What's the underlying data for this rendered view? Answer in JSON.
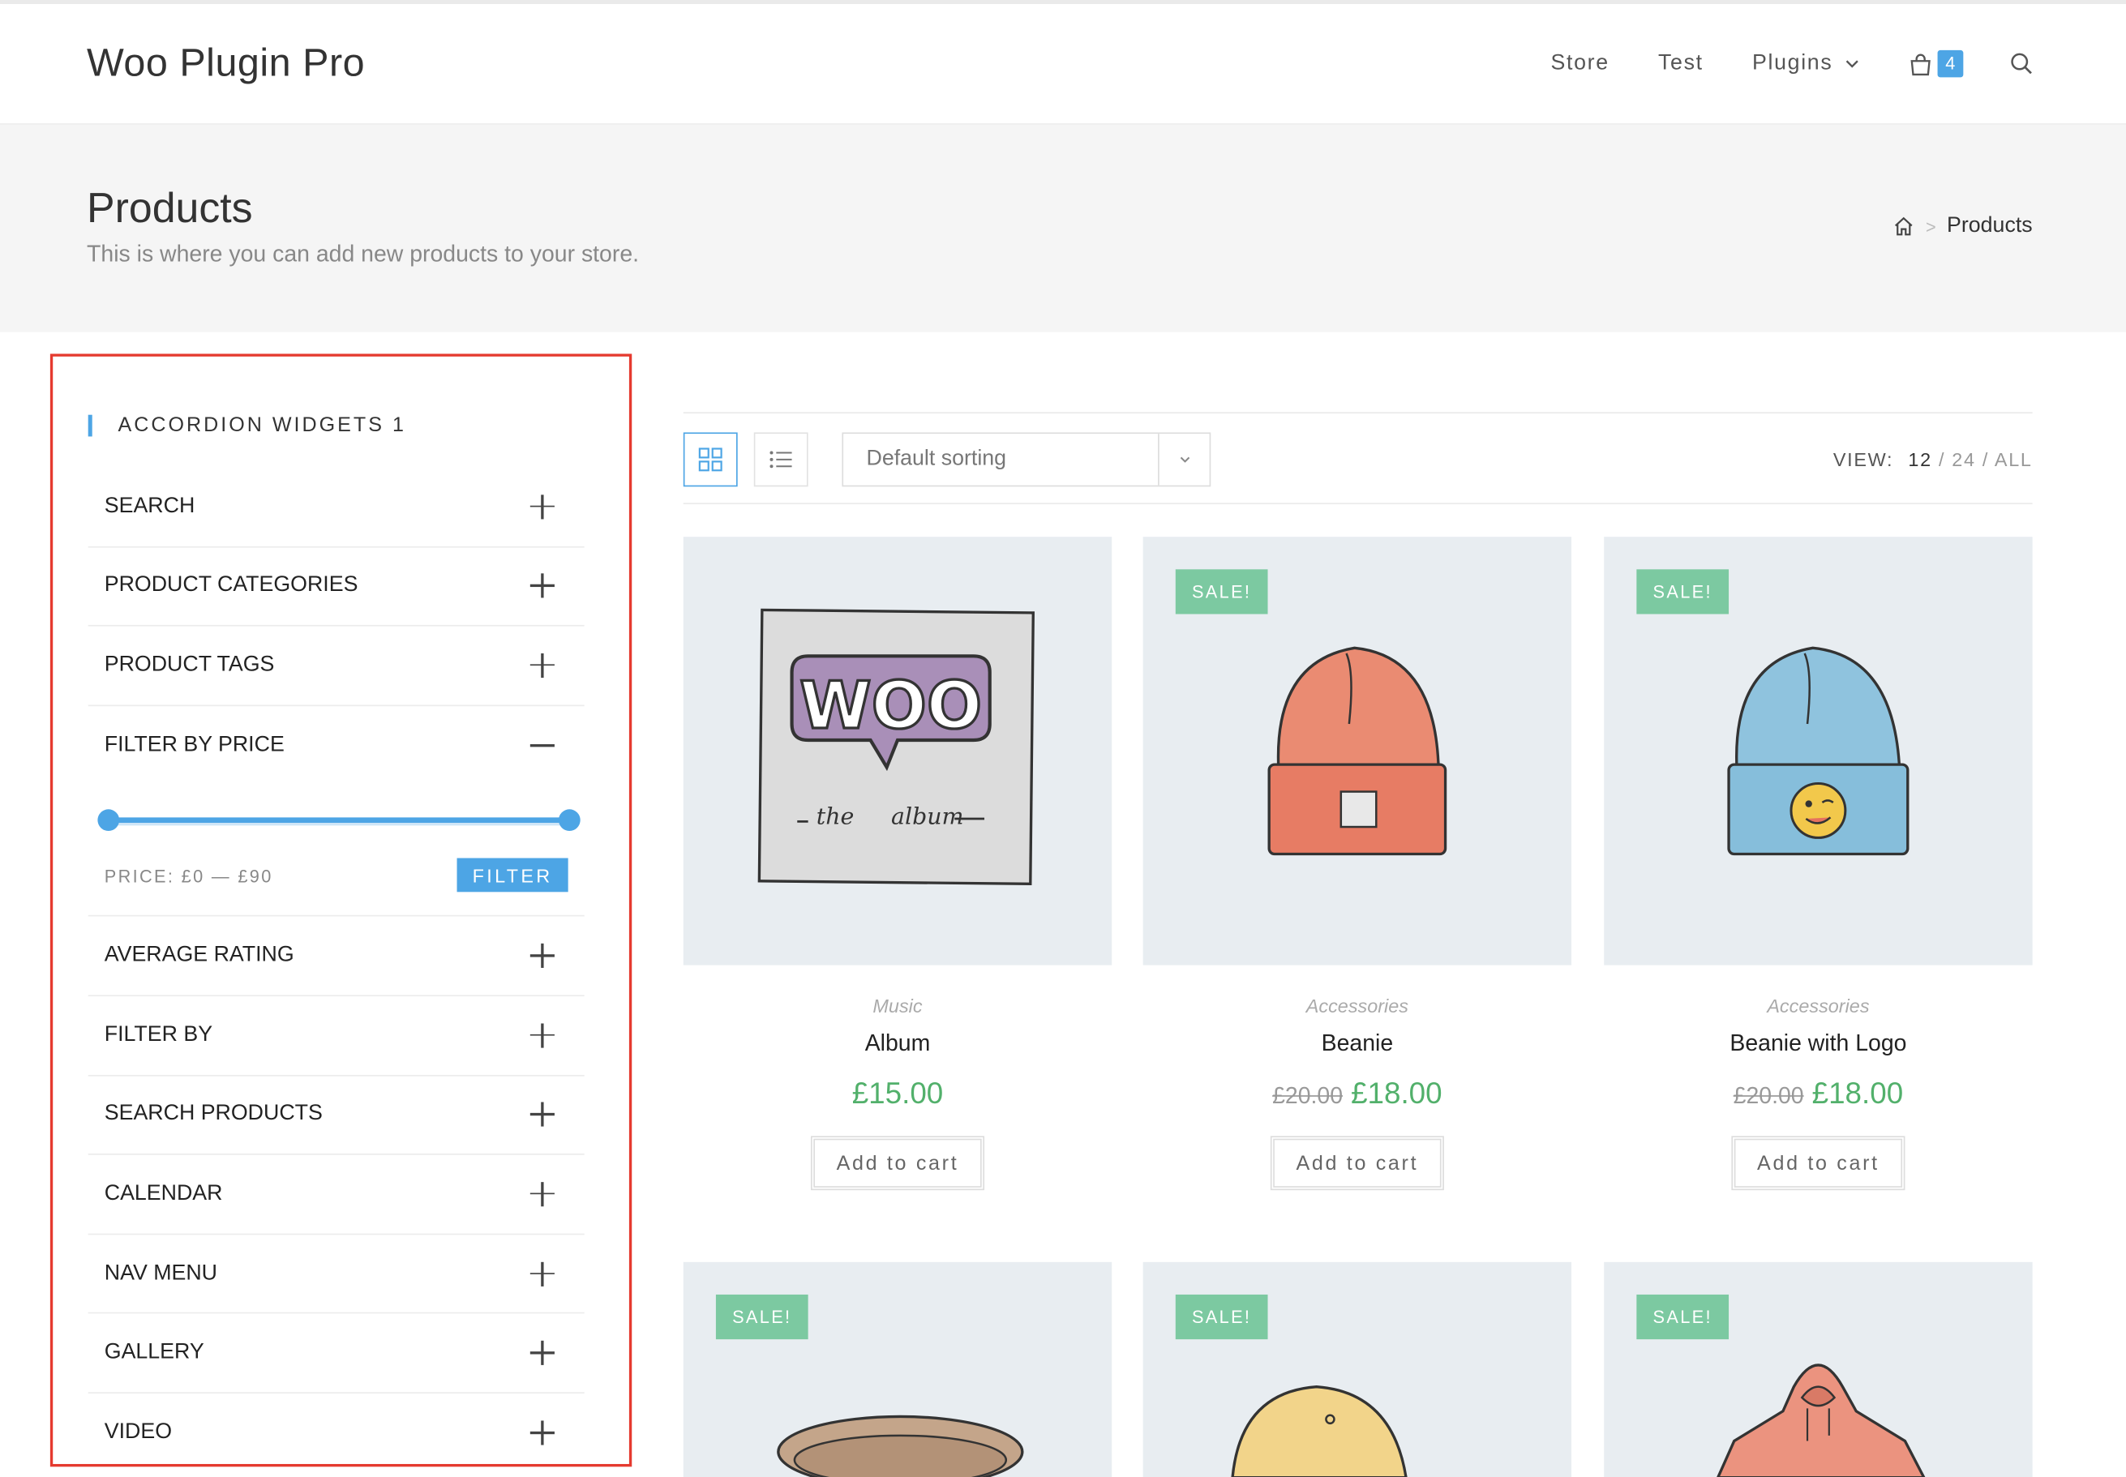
{
  "site": {
    "logo": "Woo Plugin Pro"
  },
  "nav": {
    "items": [
      "Store",
      "Test",
      "Plugins"
    ],
    "cart_count": "4"
  },
  "page": {
    "title": "Products",
    "subtitle": "This is where you can add new products to your store.",
    "breadcrumb_current": "Products"
  },
  "sidebar": {
    "widget_title": "ACCORDION WIDGETS 1",
    "items_top": [
      "SEARCH",
      "PRODUCT CATEGORIES",
      "PRODUCT TAGS",
      "FILTER BY PRICE"
    ],
    "price_filter": {
      "label": "PRICE: £0 — £90",
      "button": "FILTER",
      "min": 0,
      "max": 90
    },
    "items_bottom": [
      "AVERAGE RATING",
      "FILTER BY",
      "SEARCH PRODUCTS",
      "CALENDAR",
      "NAV MENU",
      "GALLERY",
      "VIDEO"
    ]
  },
  "toolbar": {
    "sorting": "Default sorting",
    "view_label": "VIEW:",
    "view_current": "12",
    "view_options": "/ 24 / ALL"
  },
  "products": [
    {
      "category": "Music",
      "name": "Album",
      "price": "£15.00",
      "old_price": "",
      "sale": "",
      "add": "Add to cart"
    },
    {
      "category": "Accessories",
      "name": "Beanie",
      "price": "£18.00",
      "old_price": "£20.00",
      "sale": "SALE!",
      "add": "Add to cart"
    },
    {
      "category": "Accessories",
      "name": "Beanie with Logo",
      "price": "£18.00",
      "old_price": "£20.00",
      "sale": "SALE!",
      "add": "Add to cart"
    }
  ],
  "products_row2_sale": [
    "SALE!",
    "SALE!",
    "SALE!"
  ],
  "album_art": {
    "word": "WOO",
    "caption_left": "the",
    "caption_right": "album"
  },
  "colors": {
    "accent": "#4da5e5",
    "sale": "#7cc9a1",
    "price": "#52b06b",
    "highlight_border": "#e53a2f"
  }
}
